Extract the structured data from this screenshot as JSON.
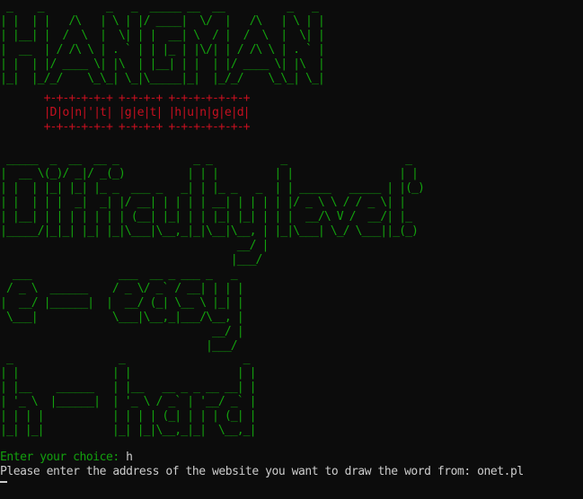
{
  "banner": {
    "title_art": " _    _          _   _  _____ __  __          _   _ \n| |  | |   /\\   | \\ | |/ ____|  \\/  |   /\\   | \\ | |\n| |__| |  /  \\  |  \\| | |  __| \\  / |  /  \\  |  \\| |\n|  __  | / /\\ \\ | . ` | | |_ | |\\/| | / /\\ \\ | . ` |\n| |  | |/ ____ \\| |\\  | |__| | |  | |/ ____ \\| |\\  |\n|_|  |_/_/    \\_\\_| \\_|\\_____|_|  |_/_/    \\_\\_| \\_|",
    "subtitle_art": "       +-+-+-+-+-+ +-+-+-+ +-+-+-+-+-+-+\n       |D|o|n|'|t| |g|e|t| |h|u|n|g|e|d|\n       +-+-+-+-+-+ +-+-+-+ +-+-+-+-+-+-+"
  },
  "menu": {
    "difficulty_art": " _____  _  __  __ _            _ _           _                   _ \n|  __ \\(_)/ _|/ _(_)          | | |         | |                 | |\n| |  | |_| |_| |_ _  ___ _   _| | |_ _   _  | | _____   _____ | |(_)\n| |  | | |  _|  _| |/ __| | | | | __| | | | | |/ _ \\ \\ / / _ \\| |\n| |__| | | | | | | | (__| |_| | | |_| |_| | | |  __/\\ V /  __/| |_\n|_____/|_|_| |_| |_|\\___|\\__,_|_|\\__|\\__, | |_|\\___| \\_/ \\___||_(_)\n                                      __/ |\n                                     |___/",
    "easy_art": "  ___              ___  __ _ ___ _   _ \n / _ \\  ______    / _ \\/ _` / __| | | |\n|  __/ |______|  |  __/ (_| \\__ \\ |_| |\n \\___|            \\___|\\__,_|___/\\__, |\n                                  __/ |\n                                 |___/",
    "hard_art": " _                 _                   _ \n| |               | |                 | |\n| |__    ______   | |__   __ _ _ __ __| |\n| '_ \\  |______|  | '_ \\ / _` | '__/ _` |\n| | | |           | | | | (_| | | | (_| |\n|_| |_|           |_| |_|\\__,_|_|  \\__,_|"
  },
  "prompts": {
    "choice_label": "Enter your choice: ",
    "choice_value": "h",
    "address_label": "Please enter the address of the website you want to draw the word from: ",
    "address_value": "onet.pl"
  },
  "colors": {
    "background": "#0c0c0c",
    "art_green": "#13a10e",
    "subtitle_red": "#c50f1f",
    "text_gray": "#cccccc"
  }
}
